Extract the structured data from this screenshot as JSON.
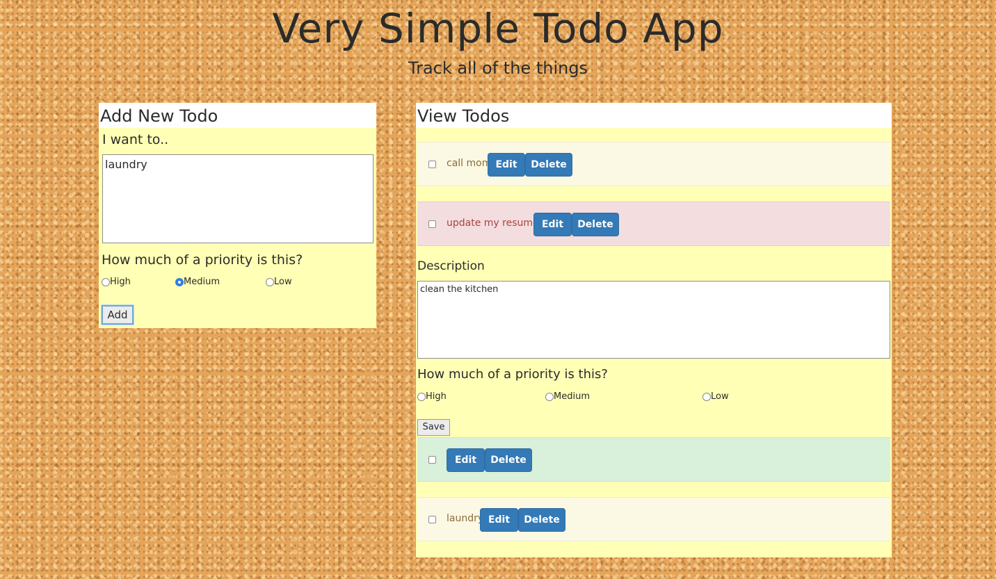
{
  "header": {
    "title": "Very Simple Todo App",
    "subtitle": "Track all of the things"
  },
  "add_panel": {
    "title": "Add New Todo",
    "prompt_label": "I want to..",
    "textarea_value": "laundry",
    "priority_label": "How much of a priority is this?",
    "priority_options": [
      "High",
      "Medium",
      "Low"
    ],
    "selected_priority": "Medium",
    "add_label": "Add"
  },
  "view_panel": {
    "title": "View Todos",
    "edit_label": "Edit",
    "delete_label": "Delete",
    "todos": [
      {
        "text": "call mom",
        "priority": "Low",
        "color": "#fbf8e3"
      },
      {
        "text": "update my resume",
        "priority": "High",
        "color": "#f3dddf"
      },
      {
        "text": "",
        "priority": "Medium",
        "color": "#d9f0da"
      },
      {
        "text": "laundry",
        "priority": "Low",
        "color": "#fbf8e3"
      }
    ],
    "edit_form": {
      "description_label": "Description",
      "description_value": "clean the kitchen",
      "priority_label": "How much of a priority is this?",
      "priority_options": [
        "High",
        "Medium",
        "Low"
      ],
      "save_label": "Save"
    }
  },
  "colors": {
    "panel_bg": "#ffffb6",
    "button_blue": "#337ab7",
    "high_text": "#a94442",
    "low_text": "#8a6d3b"
  }
}
